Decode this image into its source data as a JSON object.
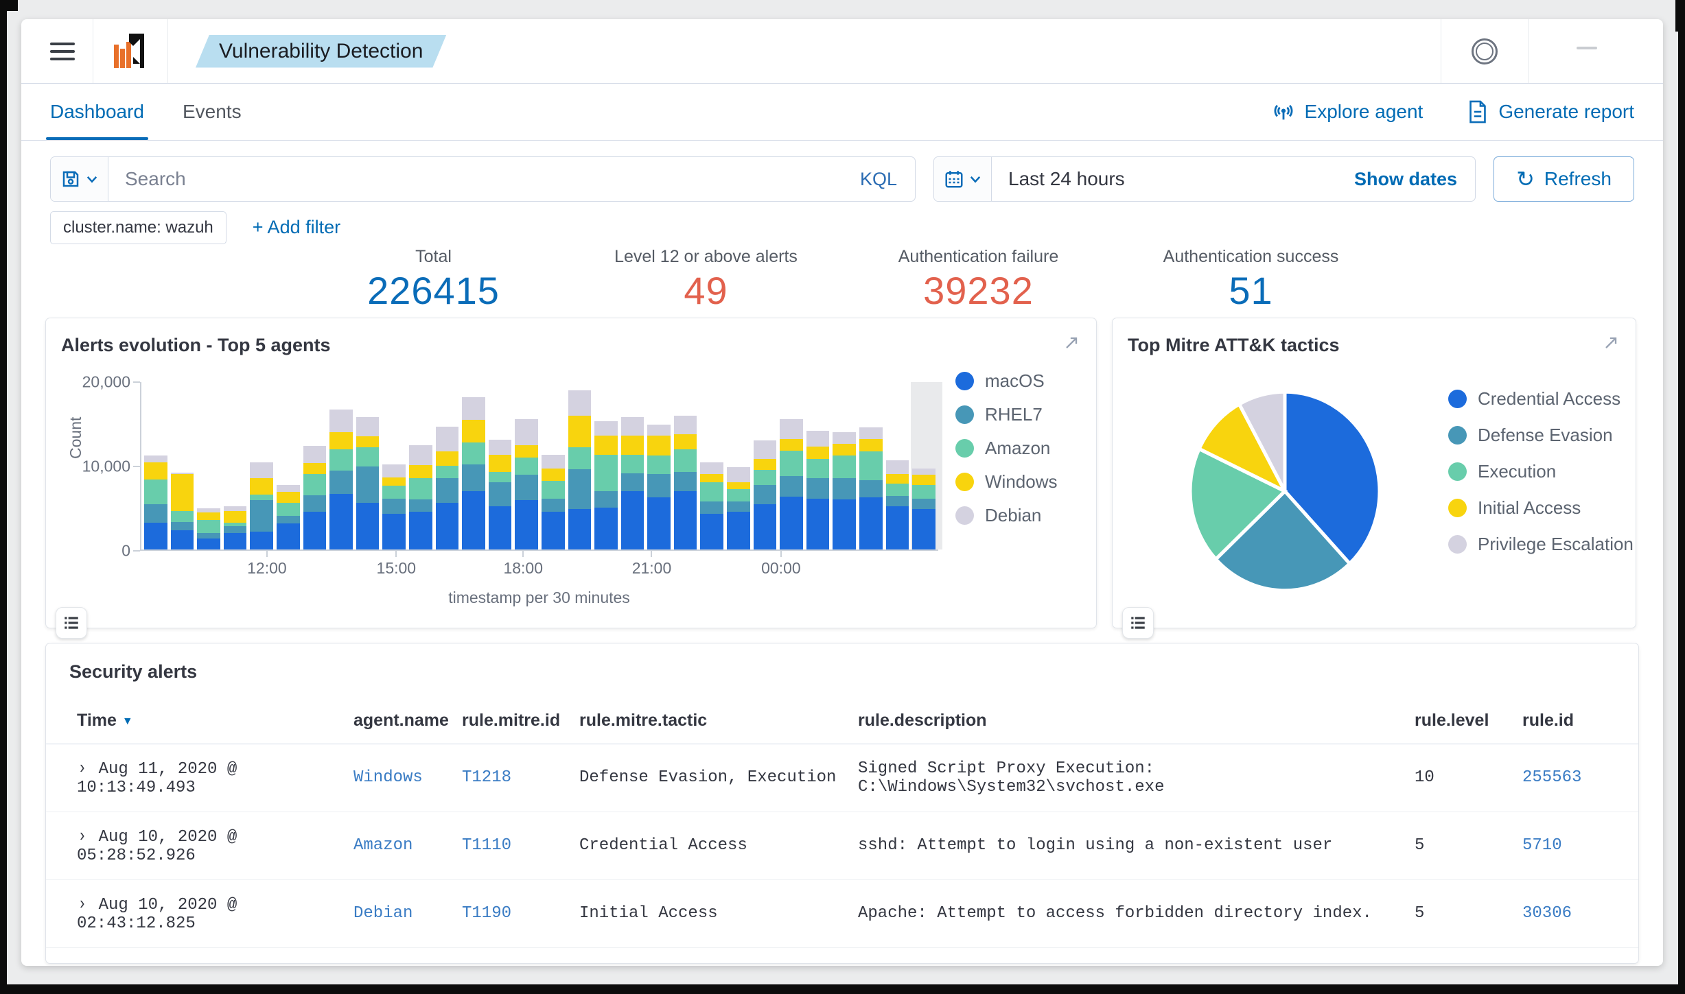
{
  "header": {
    "badge": "Vulnerability Detection"
  },
  "tabs": [
    {
      "label": "Dashboard",
      "active": true
    },
    {
      "label": "Events",
      "active": false
    }
  ],
  "actions": {
    "explore_agent": "Explore agent",
    "generate_report": "Generate report"
  },
  "search": {
    "placeholder": "Search",
    "language": "KQL"
  },
  "datepicker": {
    "value": "Last 24 hours",
    "show_dates": "Show dates",
    "refresh": "Refresh"
  },
  "filters": {
    "pill": "cluster.name: wazuh",
    "add": "+ Add filter"
  },
  "stats": [
    {
      "label": "Total",
      "value": "226415",
      "color": "#0a6cb8"
    },
    {
      "label": "Level 12 or above alerts",
      "value": "49",
      "color": "#e2614d"
    },
    {
      "label": "Authentication failure",
      "value": "39232",
      "color": "#e2614d"
    },
    {
      "label": "Authentication success",
      "value": "51",
      "color": "#0a6cb8"
    }
  ],
  "chart_data": [
    {
      "type": "bar",
      "stacked": true,
      "title": "Alerts evolution - Top 5 agents",
      "xlabel": "timestamp per 30 minutes",
      "ylabel": "Count",
      "ylim": [
        0,
        20000
      ],
      "y_ticks": [
        "0",
        "10,000",
        "20,000"
      ],
      "x_ticks": [
        {
          "label": "12:00",
          "frac": 0.159
        },
        {
          "label": "15:00",
          "frac": 0.321
        },
        {
          "label": "18:00",
          "frac": 0.48
        },
        {
          "label": "21:00",
          "frac": 0.641
        },
        {
          "label": "00:00",
          "frac": 0.803
        }
      ],
      "n_buckets": 30,
      "partial_bucket_overlay": true,
      "overlay_color": "#e7e8ea",
      "legend_position": "right",
      "grid": false,
      "series": [
        {
          "name": "macOS",
          "color": "#1c6bdc",
          "values": [
            3200,
            2300,
            1300,
            2000,
            2100,
            3100,
            4500,
            6600,
            5600,
            4300,
            4500,
            5600,
            7000,
            5200,
            5900,
            4500,
            4800,
            5000,
            7000,
            6200,
            7000,
            4300,
            4500,
            5400,
            6300,
            6100,
            6000,
            6200,
            5200,
            4800
          ]
        },
        {
          "name": "RHEL7",
          "color": "#4797b7",
          "values": [
            2200,
            1000,
            700,
            800,
            3800,
            900,
            2000,
            2800,
            4300,
            1800,
            1500,
            2900,
            3200,
            2800,
            3000,
            1600,
            4800,
            2000,
            2100,
            2800,
            2300,
            1400,
            1200,
            2300,
            2500,
            2400,
            2500,
            2100,
            1200,
            1300
          ]
        },
        {
          "name": "Amazon",
          "color": "#68cdab",
          "values": [
            3000,
            1300,
            1500,
            400,
            700,
            1600,
            2500,
            2600,
            2300,
            1500,
            2500,
            1500,
            2600,
            1300,
            2100,
            2100,
            2600,
            4300,
            2200,
            2200,
            2700,
            2300,
            1500,
            1800,
            3000,
            2300,
            2700,
            3400,
            1500,
            1600
          ]
        },
        {
          "name": "Windows",
          "color": "#f8d40e",
          "values": [
            2000,
            4400,
            900,
            1400,
            1900,
            1300,
            1300,
            2000,
            1300,
            1000,
            1600,
            1700,
            2700,
            2000,
            1500,
            1500,
            3800,
            2300,
            2300,
            2400,
            1800,
            1000,
            800,
            1300,
            1400,
            1500,
            1400,
            1500,
            1100,
            1200
          ]
        },
        {
          "name": "Debian",
          "color": "#d4d2e0",
          "values": [
            800,
            200,
            500,
            600,
            1900,
            800,
            2100,
            2700,
            2300,
            1600,
            2400,
            3000,
            2700,
            1800,
            3100,
            1600,
            3000,
            1700,
            2200,
            1300,
            2200,
            1400,
            1800,
            2200,
            2400,
            1900,
            1400,
            1400,
            1700,
            800
          ]
        }
      ]
    },
    {
      "type": "pie",
      "title": "Top Mitre ATT&K tactics",
      "legend_position": "right",
      "slices": [
        {
          "label": "Credential Access",
          "color": "#1c6bdc",
          "value": 38
        },
        {
          "label": "Defense Evasion",
          "color": "#4797b7",
          "value": 25
        },
        {
          "label": "Execution",
          "color": "#68cdab",
          "value": 19
        },
        {
          "label": "Initial Access",
          "color": "#f8d40e",
          "value": 10
        },
        {
          "label": "Privilege Escalation",
          "color": "#d4d2e0",
          "value": 8
        }
      ]
    }
  ],
  "table": {
    "title": "Security alerts",
    "columns": [
      "Time",
      "agent.name",
      "rule.mitre.id",
      "rule.mitre.tactic",
      "rule.description",
      "rule.level",
      "rule.id"
    ],
    "sorted_column": "Time",
    "rows": [
      {
        "time": "Aug 11, 2020 @ 10:13:49.493",
        "agent": "Windows",
        "mitre_id": "T1218",
        "tactic": "Defense Evasion, Execution",
        "description": "Signed Script Proxy Execution: C:\\Windows\\System32\\svchost.exe",
        "level": "10",
        "rule_id": "255563"
      },
      {
        "time": "Aug 10, 2020 @ 05:28:52.926",
        "agent": "Amazon",
        "mitre_id": "T1110",
        "tactic": "Credential Access",
        "description": "sshd: Attempt to login using a non-existent user",
        "level": "5",
        "rule_id": "5710"
      },
      {
        "time": "Aug 10, 2020 @ 02:43:12.825",
        "agent": "Debian",
        "mitre_id": "T1190",
        "tactic": "Initial Access",
        "description": "Apache: Attempt to access forbidden directory index.",
        "level": "5",
        "rule_id": "30306"
      }
    ]
  }
}
